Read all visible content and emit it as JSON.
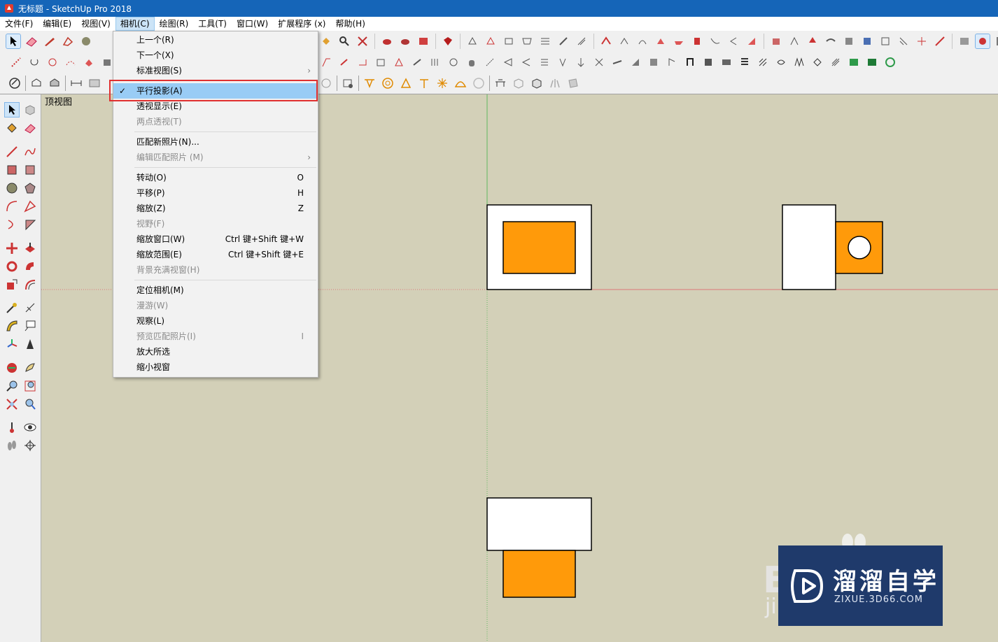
{
  "window": {
    "title": "无标题 - SketchUp Pro 2018"
  },
  "menubar": {
    "items": [
      "文件(F)",
      "编辑(E)",
      "视图(V)",
      "相机(C)",
      "绘图(R)",
      "工具(T)",
      "窗口(W)",
      "扩展程序 (x)",
      "帮助(H)"
    ],
    "active": "相机(C)"
  },
  "camera_menu": {
    "previous": "上一个(R)",
    "next": "下一个(X)",
    "standard_views": "标准视图(S)",
    "parallel_projection": "平行投影(A)",
    "perspective": "透视显示(E)",
    "two_point": "两点透视(T)",
    "match_new_photo": "匹配新照片(N)...",
    "edit_matched_photo": "编辑匹配照片 (M)",
    "orbit": "转动(O)",
    "orbit_key": "O",
    "pan": "平移(P)",
    "pan_key": "H",
    "zoom": "缩放(Z)",
    "zoom_key": "Z",
    "field_of_view": "视野(F)",
    "zoom_window": "缩放窗口(W)",
    "zoom_window_key": "Ctrl 键+Shift 键+W",
    "zoom_extents": "缩放范围(E)",
    "zoom_extents_key": "Ctrl 键+Shift 键+E",
    "zoom_background": "背景充满视窗(H)",
    "position_camera": "定位相机(M)",
    "walk": "漫游(W)",
    "look_around": "观察(L)",
    "preview_matched_photo": "预览匹配照片(I)",
    "preview_key": "I",
    "zoom_selection": "放大所选",
    "zoom_out_window": "缩小视窗",
    "checkmark": "✓",
    "submenu_arrow": "›"
  },
  "viewport": {
    "view_name": "顶视图"
  },
  "watermark": {
    "title": "溜溜自学",
    "subtitle": "ZIXUE.3D66.COM",
    "bg_text": "E",
    "bg_text2": "ji"
  },
  "colors": {
    "orange": "#ff9a0a",
    "title_bar": "#1565b8",
    "highlight": "#99ccf5",
    "red_box": "#e03030",
    "canvas": "#d3d0b8"
  }
}
